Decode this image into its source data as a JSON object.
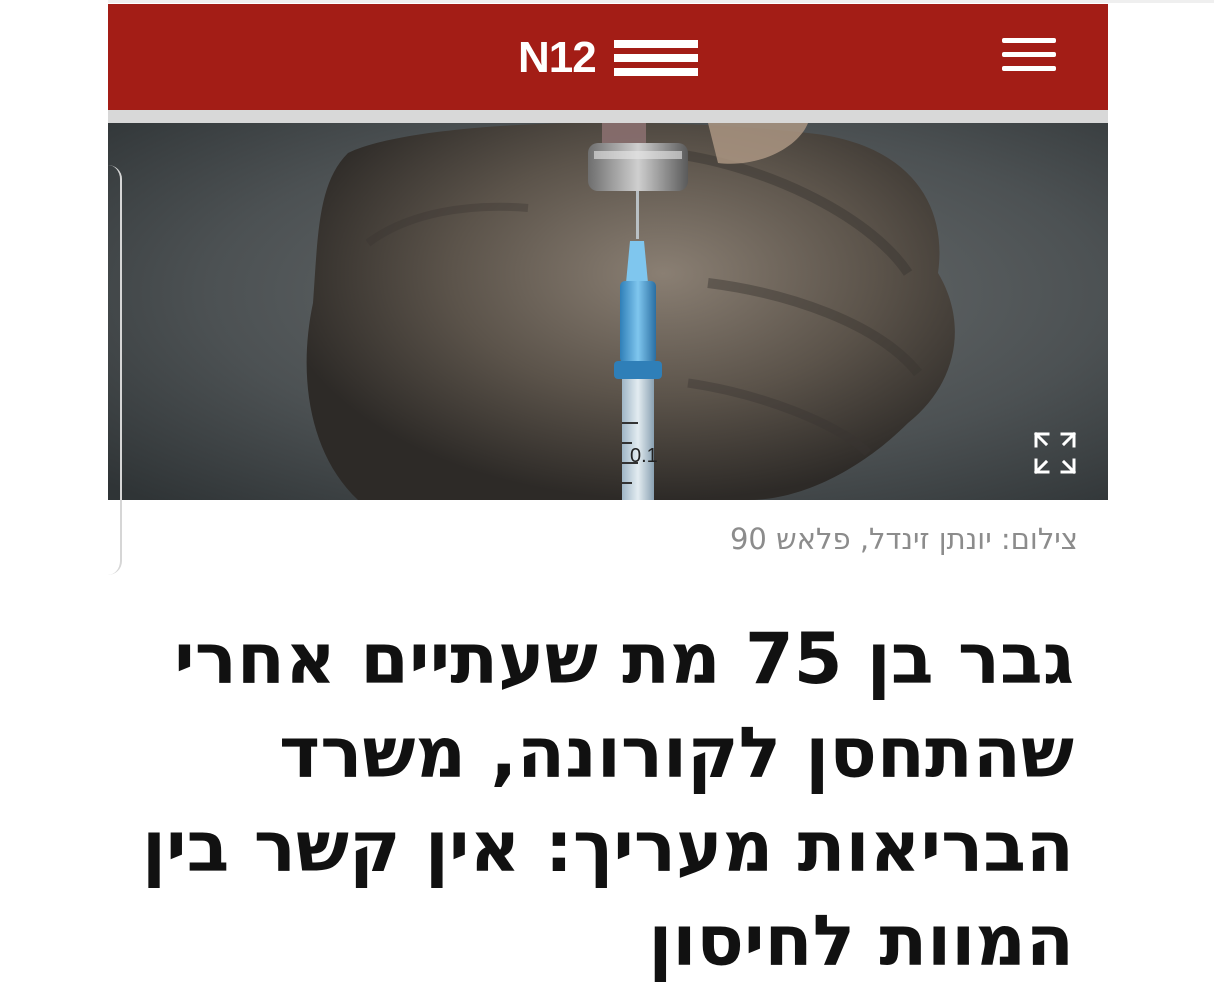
{
  "header": {
    "logo_text": "N12",
    "background_color": "#a31d16"
  },
  "icons": {
    "menu": "hamburger-menu-icon",
    "expand": "expand-arrows-icon"
  },
  "hero_image": {
    "scale_label": "0.1"
  },
  "article": {
    "photo_credit": "צילום: יונתן זינדל, פלאש 90",
    "headline": "גבר בן 75 מת שעתיים אחרי שהתחסן לקורונה, משרד הבריאות מעריך: אין קשר בין המוות לחיסון"
  }
}
